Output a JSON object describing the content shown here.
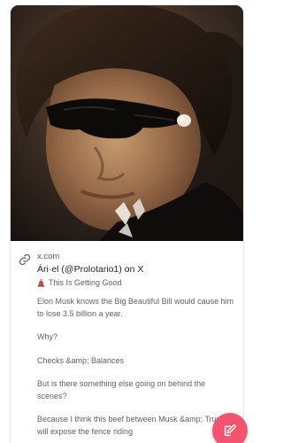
{
  "link_card": {
    "domain": "x.com",
    "title": "Ári·el (@Prolotario1) on X",
    "subtitle": "This Is Getting Good",
    "subtitle_icon": "police-siren-emoji",
    "link_icon": "link-icon",
    "image_description": "photo"
  },
  "post": {
    "paragraphs": [
      "Elon Musk knows the Big Beautiful Bill would cause him to lose 3.5 billion a year.",
      "Why?",
      "Checks &amp; Balances",
      "But is there something else going on behind the scenes?",
      "Because I think this beef between Musk &amp; Trump will expose the fence riding"
    ]
  },
  "fab": {
    "icon": "edit-icon",
    "color": "#f2546f"
  }
}
